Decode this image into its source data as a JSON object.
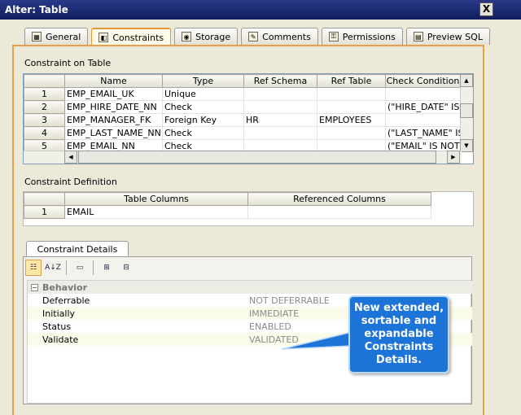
{
  "window": {
    "title": "Alter: Table",
    "close_label": "X"
  },
  "tabs": [
    {
      "label": "General",
      "icon": "grid-icon"
    },
    {
      "label": "Constraints",
      "icon": "folder-icon"
    },
    {
      "label": "Storage",
      "icon": "disk-icon"
    },
    {
      "label": "Comments",
      "icon": "note-icon"
    },
    {
      "label": "Permissions",
      "icon": "key-icon"
    },
    {
      "label": "Preview SQL",
      "icon": "sql-icon"
    }
  ],
  "constraints": {
    "section_label": "Constraint on Table",
    "columns": [
      "Name",
      "Type",
      "Ref Schema",
      "Ref Table",
      "Check Condition"
    ],
    "rows": [
      {
        "n": "1",
        "name": "EMP_EMAIL_UK",
        "type": "Unique",
        "ref_schema": "",
        "ref_table": "",
        "check": ""
      },
      {
        "n": "2",
        "name": "EMP_HIRE_DATE_NN",
        "type": "Check",
        "ref_schema": "",
        "ref_table": "",
        "check": "(\"HIRE_DATE\" IS ..."
      },
      {
        "n": "3",
        "name": "EMP_MANAGER_FK",
        "type": "Foreign Key",
        "ref_schema": "HR",
        "ref_table": "EMPLOYEES",
        "check": ""
      },
      {
        "n": "4",
        "name": "EMP_LAST_NAME_NN",
        "type": "Check",
        "ref_schema": "",
        "ref_table": "",
        "check": "(\"LAST_NAME\" IS ..."
      },
      {
        "n": "5",
        "name": "EMP_EMAIL_NN",
        "type": "Check",
        "ref_schema": "",
        "ref_table": "",
        "check": "(\"EMAIL\" IS NOT ..."
      }
    ]
  },
  "definition": {
    "section_label": "Constraint Definition",
    "columns": [
      "Table Columns",
      "Referenced Columns"
    ],
    "rows": [
      {
        "n": "1",
        "table_col": "EMAIL",
        "ref_col": ""
      }
    ]
  },
  "details": {
    "tab_label": "Constraint Details",
    "category": "Behavior",
    "category_toggle": "−",
    "toolbar_icons": [
      "categorized-icon",
      "sort-az-icon",
      "property-pages-icon",
      "expand-all-icon",
      "collapse-all-icon"
    ],
    "properties": [
      {
        "name": "Deferrable",
        "value": "NOT DEFERRABLE"
      },
      {
        "name": "Initially",
        "value": "IMMEDIATE"
      },
      {
        "name": "Status",
        "value": "ENABLED"
      },
      {
        "name": "Validate",
        "value": "VALIDATED"
      }
    ]
  },
  "callout": {
    "text": "New extended, sortable and expandable Constraints Details."
  }
}
